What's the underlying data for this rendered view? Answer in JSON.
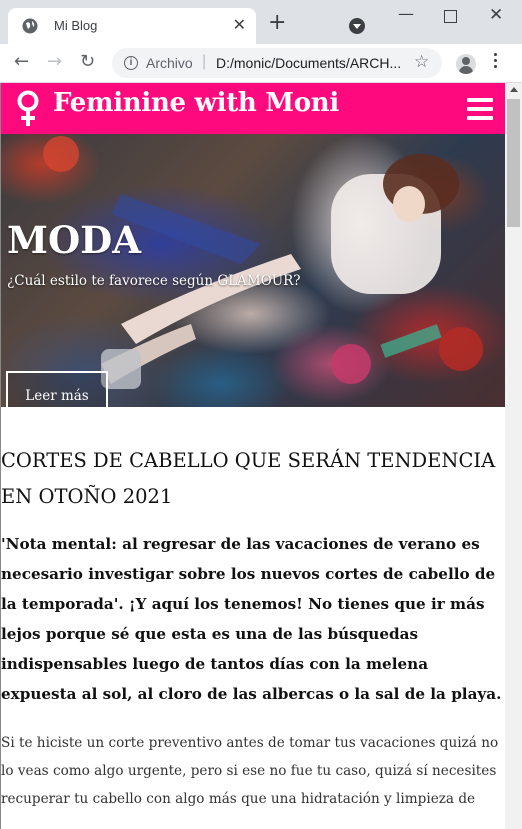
{
  "browser": {
    "tab_title": "Mi Blog",
    "tab_close": "✕",
    "new_tab": "+",
    "address_label": "Archivo",
    "address_separator": "|",
    "address_url": "D:/monic/Documents/ARCH...",
    "icons": [
      "globe-icon",
      "close-icon",
      "plus-icon",
      "tab-search-icon",
      "minimize-icon",
      "maximize-icon",
      "window-close-icon",
      "back-icon",
      "forward-icon",
      "reload-icon",
      "info-icon",
      "star-icon",
      "profile-icon",
      "menu-icon"
    ]
  },
  "site": {
    "brand_symbol": "♀",
    "brand_name": "Feminine with Moni",
    "brand_color": "#ff0a7e"
  },
  "hero": {
    "title": "MODA",
    "subtitle": "¿Cuál estilo te favorece según GLAMOUR?",
    "button_label": "Leer más"
  },
  "article": {
    "title": "CORTES DE CABELLO QUE SERÁN TENDENCIA EN OTOÑO 2021",
    "lead": "'Nota mental: al regresar de las vacaciones de verano es necesario investigar sobre los nuevos cortes de cabello de la temporada'. ¡Y aquí los tenemos! No tienes que ir más lejos porque sé que esta es una de las búsquedas indispensables luego de tantos días con la melena expuesta al sol, al cloro de las albercas o la sal de la playa.",
    "body": "Si te hiciste un corte preventivo antes de tomar tus vacaciones quizá no lo veas como algo urgente, pero si ese no fue tu caso, quizá sí necesites recuperar tu cabello con algo más que una hidratación y limpieza de"
  }
}
